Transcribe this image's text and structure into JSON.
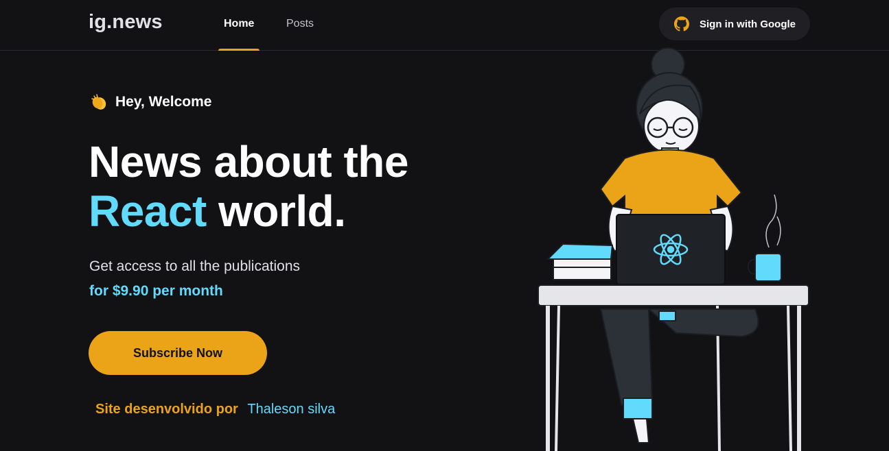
{
  "header": {
    "logo": "ig.news",
    "nav": [
      {
        "label": "Home",
        "active": true
      },
      {
        "label": "Posts",
        "active": false
      }
    ],
    "signin_label": "Sign in with Google"
  },
  "hero": {
    "greeting": "Hey, Welcome",
    "headline_part1": "News about the",
    "headline_accent": "React",
    "headline_part2": "world.",
    "subtitle": "Get access to all the publications",
    "price_line": "for $9.90 per month",
    "subscribe_label": "Subscribe Now",
    "credit_label": "Site desenvolvido por",
    "credit_author": "Thaleson silva"
  },
  "colors": {
    "background": "#121214",
    "accent_yellow": "#eba417",
    "accent_cyan": "#61dafb",
    "text": "#e1e1e6"
  },
  "icons": [
    "github-icon",
    "clapping-hands-icon",
    "react-logo-icon"
  ]
}
